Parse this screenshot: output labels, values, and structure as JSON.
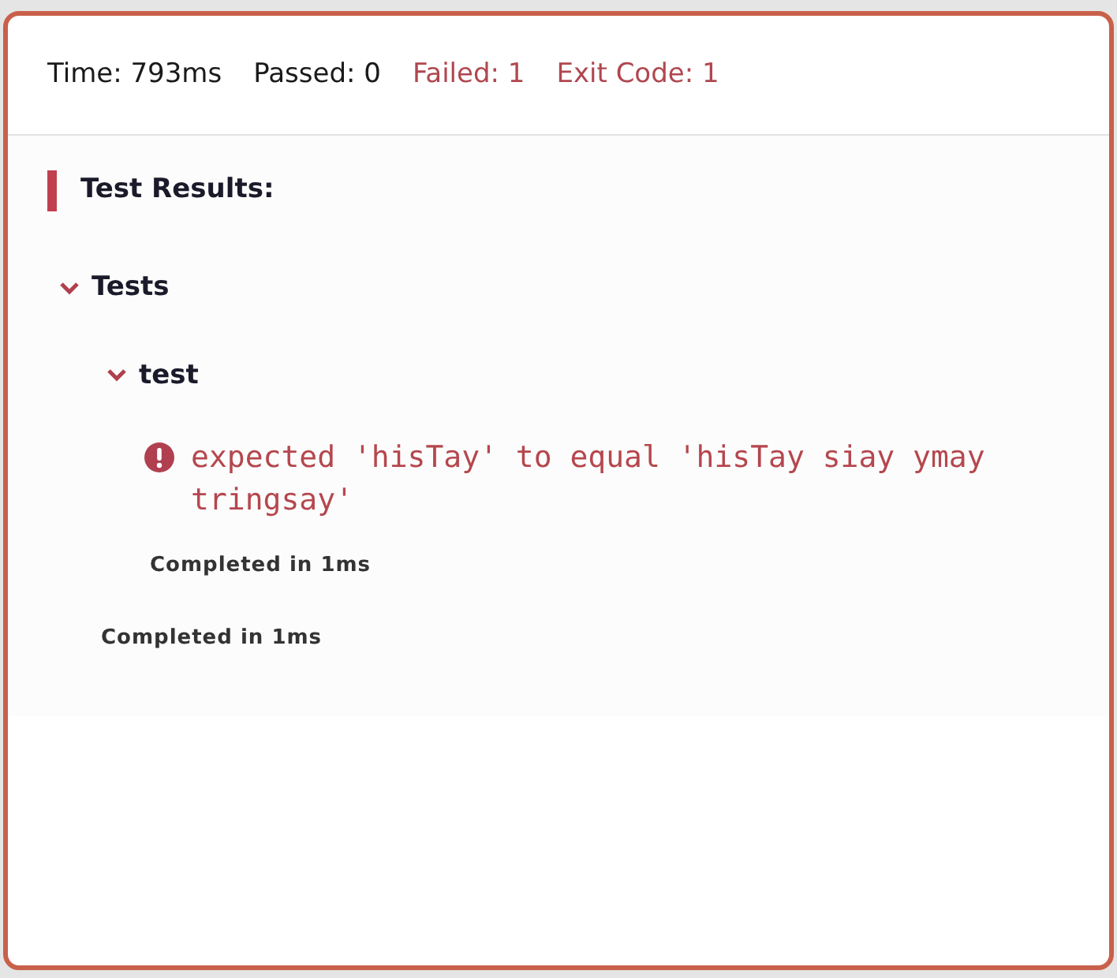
{
  "stats": [
    {
      "label": "Time: 793ms",
      "failed": false
    },
    {
      "label": "Passed: 0",
      "failed": false
    },
    {
      "label": "Failed: 1",
      "failed": true
    },
    {
      "label": "Exit Code: 1",
      "failed": true
    }
  ],
  "results": {
    "title": "Test Results:",
    "suites": [
      {
        "name": "Tests",
        "expanded": true,
        "duration": "Completed in 1ms",
        "tests": [
          {
            "name": "test",
            "expanded": true,
            "error": "expected 'hisTay' to equal 'hisTay siay ymay tringsay'",
            "duration": "Completed in 1ms"
          }
        ]
      }
    ]
  }
}
